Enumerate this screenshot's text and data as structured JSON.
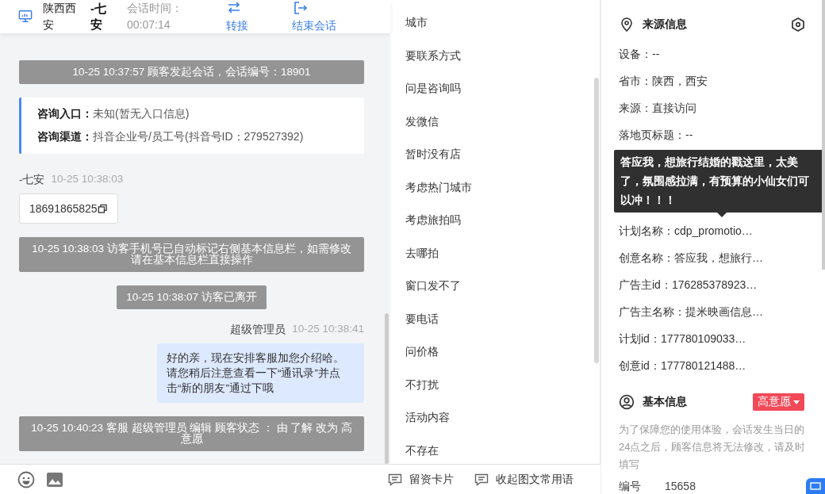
{
  "header": {
    "location": "陕西西安",
    "visitor": "-七安",
    "session_time_label": "会话时间：",
    "session_time": "00:07:14",
    "actions": [
      {
        "kind": "transfer",
        "label": "转接"
      },
      {
        "kind": "end",
        "label": "结束会话"
      }
    ]
  },
  "messages": [
    {
      "kind": "system",
      "text": "10-25 10:37:57 顾客发起会话，会话编号：18901"
    },
    {
      "kind": "info",
      "rows": [
        {
          "label": "咨询入口：",
          "value": "未知(暂无入口信息)"
        },
        {
          "label": "咨询渠道：",
          "value": "抖音企业号/员工号(抖音号ID：279527392)"
        }
      ]
    },
    {
      "kind": "incoming",
      "sender": "-七安",
      "time": "10-25 10:38:03",
      "text": "18691865825"
    },
    {
      "kind": "system",
      "text": "10-25 10:38:03 访客手机号已自动标记右侧基本信息栏，如需修改请在基本信息栏直接操作"
    },
    {
      "kind": "system",
      "text": "10-25 10:38:07 访客已离开"
    },
    {
      "kind": "outgoing",
      "sender": "超级管理员",
      "time": "10-25 10:38:41",
      "text": "好的亲，现在安排客服加您介绍哈。请您稍后注意查看一下“通讯录”并点击“新的朋友”通过下哦"
    },
    {
      "kind": "system",
      "text": "10-25 10:40:23 客服 超级管理员 编辑 顾客状态 ： 由 了解 改为 高意愿"
    }
  ],
  "toolbar": {
    "actions": [
      "留资卡片",
      "收起图文常用语"
    ]
  },
  "phrases": [
    "城市",
    "要联系方式",
    "问是咨询吗",
    "发微信",
    "暂时没有店",
    "考虑热门城市",
    "考虑旅拍吗",
    "去哪拍",
    "窗口发不了",
    "要电话",
    "问价格",
    "不打扰",
    "活动内容",
    "不存在"
  ],
  "source_info": {
    "title": "来源信息",
    "rows": [
      {
        "kind": "row",
        "text": "设备：--"
      },
      {
        "kind": "row",
        "text": "省市：陕西，西安"
      },
      {
        "kind": "row",
        "text": "来源：直接访问"
      },
      {
        "kind": "row",
        "text": "落地页标题：--"
      },
      {
        "kind": "tooltip",
        "text": "答应我，想旅行结婚的戳这里，太美了，氛围感拉满，有预算的小仙女们可以冲！！！"
      },
      {
        "kind": "row",
        "text": "计划名称：cdp_promotio…"
      },
      {
        "kind": "row",
        "text": "创意名称：答应我，想旅行…"
      },
      {
        "kind": "row",
        "text": "广告主id：176285378923…"
      },
      {
        "kind": "row",
        "text": "广告主名称：提米映画信息…"
      },
      {
        "kind": "row",
        "text": "计划id：177780109033…"
      },
      {
        "kind": "row",
        "text": "创意id：177780121488…"
      }
    ]
  },
  "basic_info": {
    "title": "基本信息",
    "intent": "高意愿",
    "notice": "为了保障您的使用体验，会话发生当日的24点之后，顾客信息将无法修改，请及时填写",
    "fields": [
      {
        "label": "编号",
        "value": "15658"
      }
    ]
  }
}
